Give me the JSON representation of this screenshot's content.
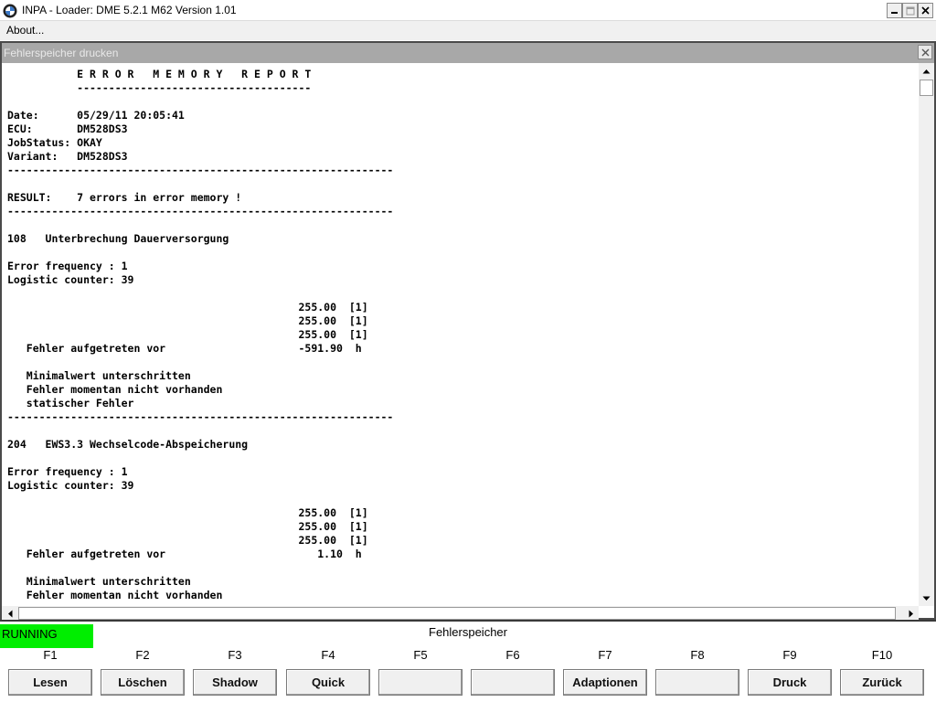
{
  "window": {
    "title": "INPA - Loader:  DME 5.2.1 M62 Version 1.01",
    "icon": "bmw-logo-icon"
  },
  "menu": {
    "about": "About..."
  },
  "child_window": {
    "title": "Fehlerspeicher drucken"
  },
  "report": {
    "lines": [
      "           E R R O R   M E M O R Y   R E P O R T",
      "           -------------------------------------",
      "",
      "Date:      05/29/11 20:05:41",
      "ECU:       DM528DS3",
      "JobStatus: OKAY",
      "Variant:   DM528DS3",
      "-------------------------------------------------------------",
      "",
      "RESULT:    7 errors in error memory !",
      "-------------------------------------------------------------",
      "",
      "108   Unterbrechung Dauerversorgung",
      "",
      "Error frequency : 1",
      "Logistic counter: 39",
      "",
      "                                              255.00  [1]",
      "                                              255.00  [1]",
      "                                              255.00  [1]",
      "   Fehler aufgetreten vor                     -591.90  h",
      "",
      "   Minimalwert unterschritten",
      "   Fehler momentan nicht vorhanden",
      "   statischer Fehler",
      "-------------------------------------------------------------",
      "",
      "204   EWS3.3 Wechselcode-Abspeicherung",
      "",
      "Error frequency : 1",
      "Logistic counter: 39",
      "",
      "                                              255.00  [1]",
      "                                              255.00  [1]",
      "                                              255.00  [1]",
      "   Fehler aufgetreten vor                        1.10  h",
      "",
      "   Minimalwert unterschritten",
      "   Fehler momentan nicht vorhanden"
    ]
  },
  "status": {
    "running": "RUNNING",
    "color": "#00ee00"
  },
  "panel": {
    "title": "Fehlerspeicher",
    "keys": [
      "F1",
      "F2",
      "F3",
      "F4",
      "F5",
      "F6",
      "F7",
      "F8",
      "F9",
      "F10"
    ],
    "buttons": [
      "Lesen",
      "Löschen",
      "Shadow",
      "Quick",
      "",
      "",
      "Adaptionen",
      "",
      "Druck",
      "Zurück"
    ]
  }
}
